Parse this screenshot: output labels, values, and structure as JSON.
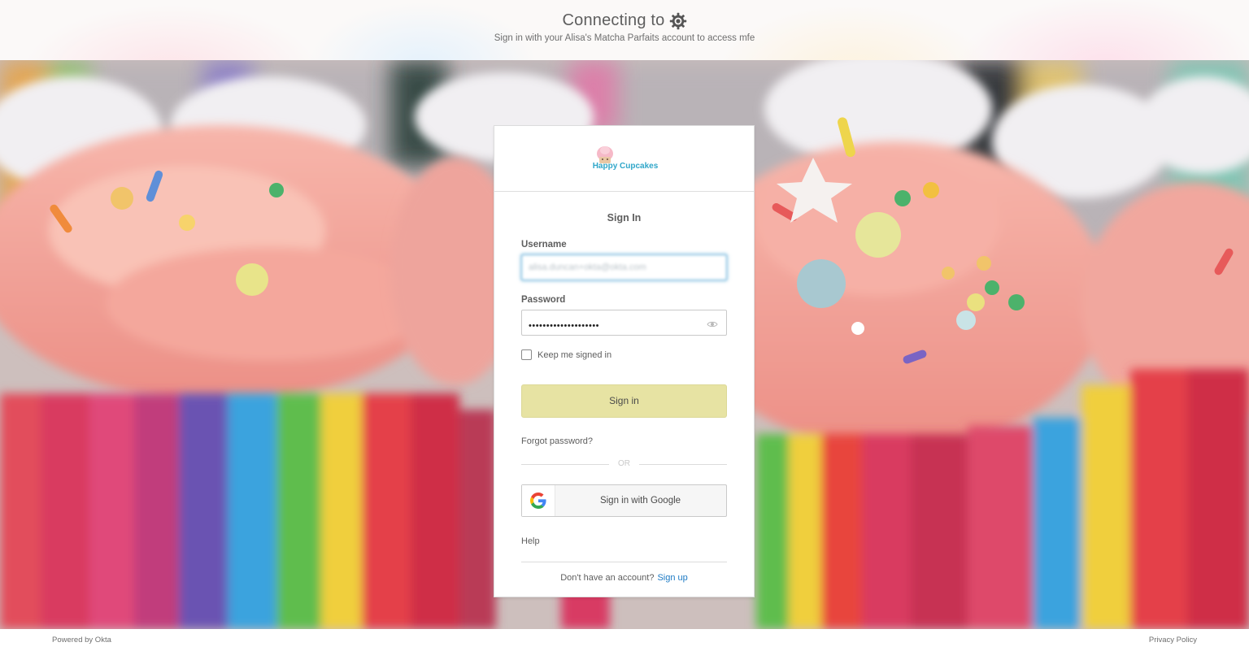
{
  "banner": {
    "title": "Connecting to",
    "app_icon": "gear-icon",
    "subtitle": "Sign in with your Alisa's Matcha Parfaits account to access mfe"
  },
  "background": {
    "description_icon": "cupcakes-background-image"
  },
  "brand": {
    "logo_text": "Happy Cupcakes",
    "logo_icon": "cupcake-logo-icon",
    "logo_color": "#2fa6c9"
  },
  "form": {
    "title": "Sign In",
    "username_label": "Username",
    "username_value": "alisa.duncan+okta@okta.com",
    "password_label": "Password",
    "password_masked": "••••••••••••••••••••",
    "password_toggle_icon": "eye-icon",
    "remember_label": "Keep me signed in",
    "remember_checked": false,
    "submit_label": "Sign in",
    "forgot_label": "Forgot password?",
    "or_label": "OR",
    "google_label": "Sign in with Google",
    "google_icon": "google-g-icon",
    "help_label": "Help",
    "no_account_text": "Don't have an account?",
    "signup_label": "Sign up"
  },
  "colors": {
    "primary_button": "#e7e3a3",
    "link": "#1d7ac4",
    "focus_border": "#5aa9d6"
  },
  "footer": {
    "powered_by": "Powered by Okta",
    "privacy": "Privacy Policy"
  }
}
